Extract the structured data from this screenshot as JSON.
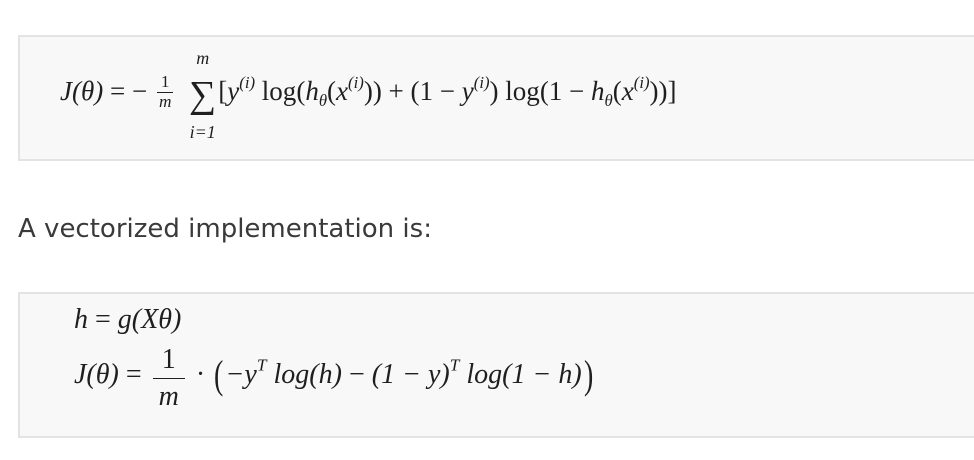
{
  "cost_function": {
    "lhs": "J(θ)",
    "equals": "=",
    "minus": "−",
    "frac_num": "1",
    "frac_den": "m",
    "sum_upper": "m",
    "sum_lower": "i=1",
    "sum_symbol": "∑",
    "bracket_open": "[",
    "y": "y",
    "superscript_i": "(i)",
    "log": "log",
    "h": "h",
    "theta_sub": "θ",
    "x": "x",
    "one_minus": "(1 − ",
    "bracket_close": "))]"
  },
  "intro_text": "A vectorized implementation is:",
  "vectorized": {
    "line1_lhs": "h",
    "line1_eq": "=",
    "line1_rhs": "g(Xθ)",
    "line2_lhs": "J(θ)",
    "line2_eq": "=",
    "frac_num": "1",
    "frac_den": "m",
    "dot": "·",
    "paren_open": "(",
    "paren_close": ")",
    "term_a": "−y",
    "sup_T": "T",
    "log_h": "log(h)",
    "minus": "−",
    "term_b": "(1 − y)",
    "log_1mh": "log(1 − h)"
  }
}
